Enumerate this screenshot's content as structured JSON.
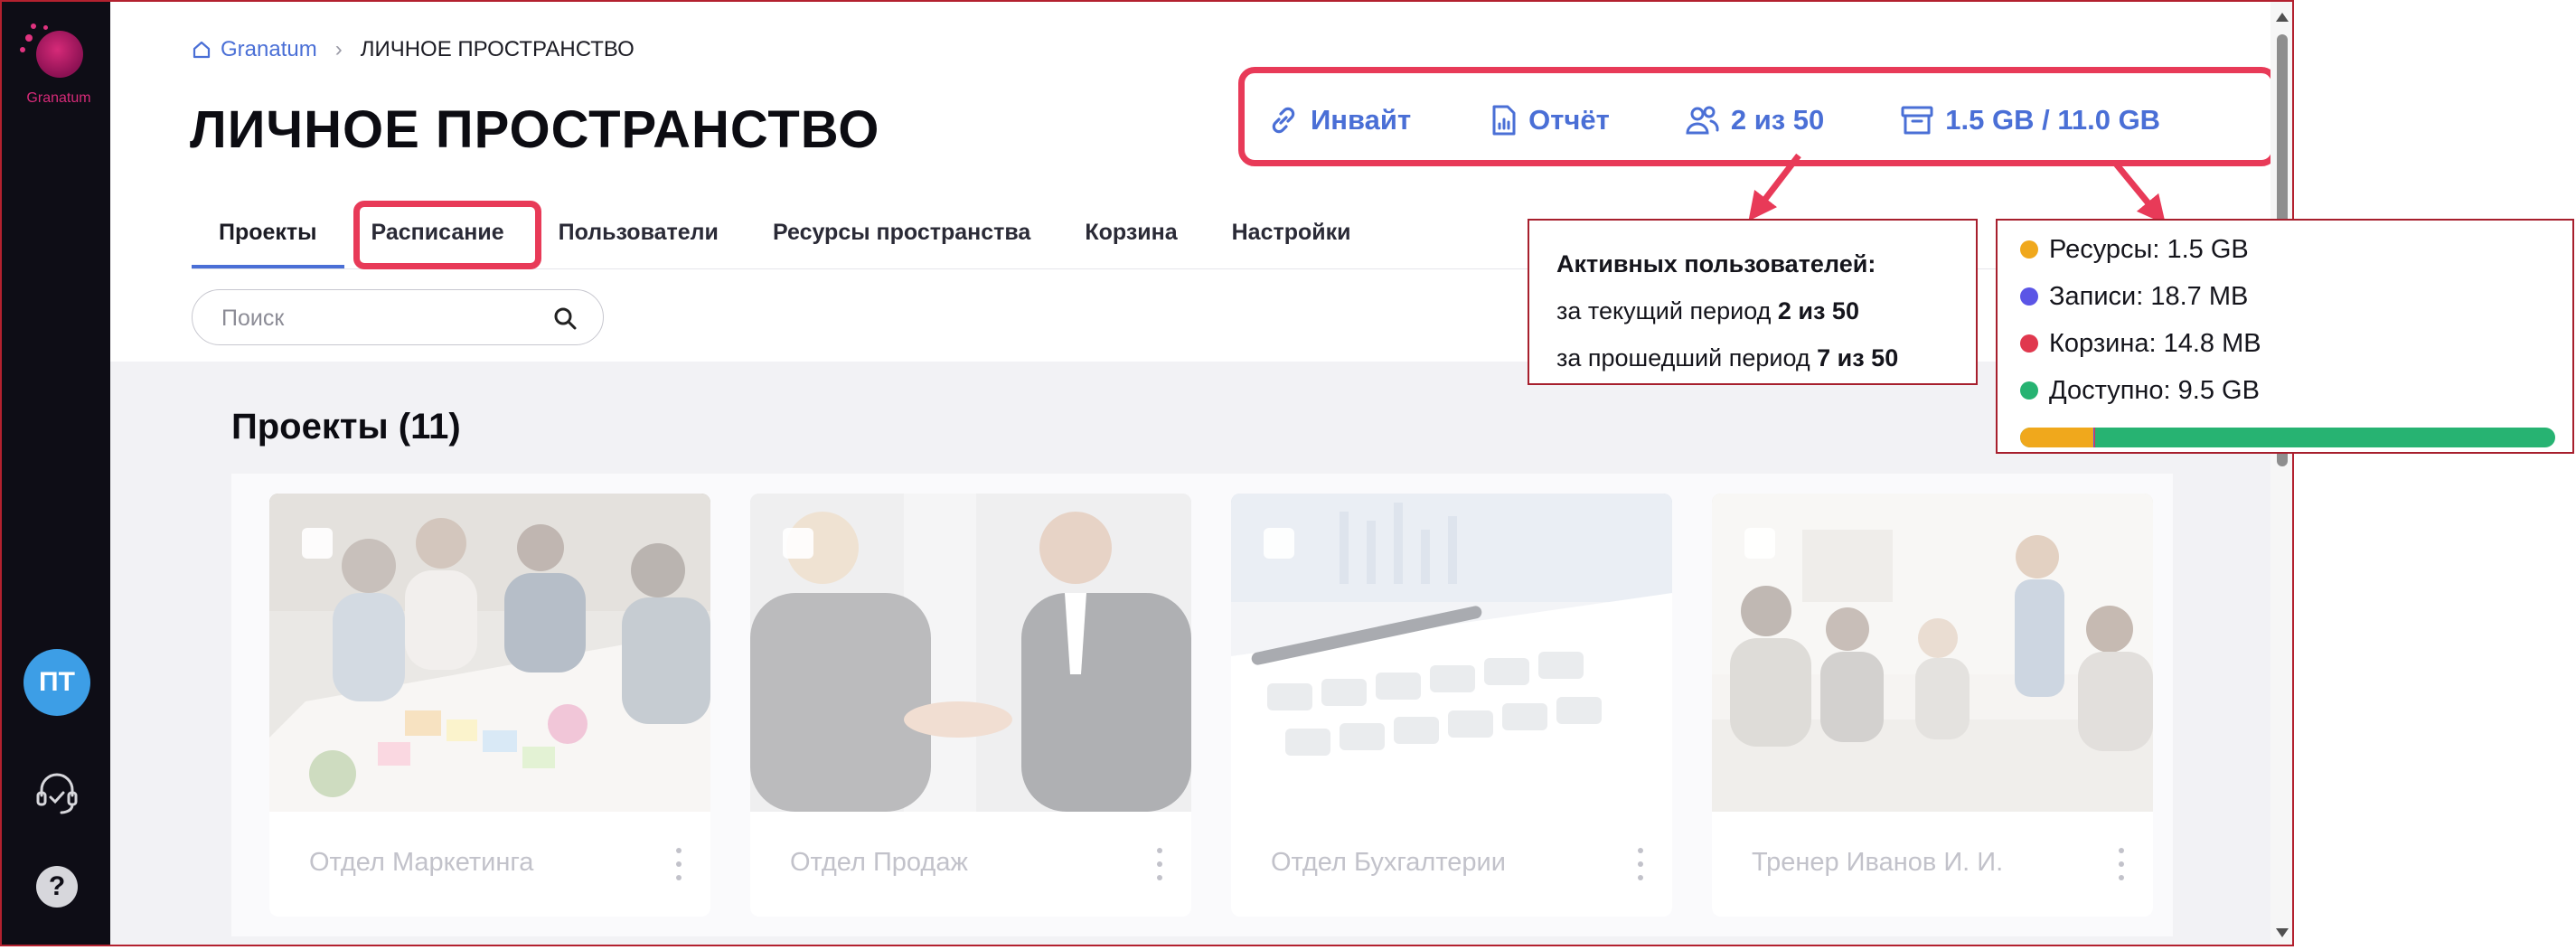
{
  "sidebar": {
    "logo_text": "Granatum",
    "avatar_initials": "ПТ",
    "help_label": "?"
  },
  "breadcrumb": {
    "home": "Granatum",
    "separator": "›",
    "current": "ЛИЧНОЕ ПРОСТРАНСТВО"
  },
  "page": {
    "title": "ЛИЧНОЕ ПРОСТРАНСТВО"
  },
  "tabs": [
    {
      "label": "Проекты",
      "active": true
    },
    {
      "label": "Расписание",
      "active": false
    },
    {
      "label": "Пользователи",
      "active": false
    },
    {
      "label": "Ресурсы пространства",
      "active": false
    },
    {
      "label": "Корзина",
      "active": false
    },
    {
      "label": "Настройки",
      "active": false
    }
  ],
  "stats": {
    "invite_label": "Инвайт",
    "report_label": "Отчёт",
    "users_label": "2 из 50",
    "storage_label": "1.5 GB / 11.0 GB",
    "icon_names": [
      "link-icon",
      "report-icon",
      "users-icon",
      "archive-icon"
    ]
  },
  "search": {
    "placeholder": "Поиск",
    "value": ""
  },
  "projects": {
    "title": "Проекты (11)",
    "cards": [
      {
        "title": "Отдел Маркетинга",
        "image": "team-meeting-photo"
      },
      {
        "title": "Отдел Продаж",
        "image": "handshake-photo"
      },
      {
        "title": "Отдел Бухгалтерии",
        "image": "calculator-photo"
      },
      {
        "title": "Тренер Иванов И. И.",
        "image": "presentation-photo"
      }
    ]
  },
  "callouts": {
    "users": {
      "heading": "Активных пользователей:",
      "current_prefix": "за текущий период ",
      "current_value": "2 из 50",
      "past_prefix": "за прошедший период ",
      "past_value": "7 из 50"
    },
    "storage": {
      "items": [
        {
          "label": "Ресурсы: 1.5 GB",
          "color": "#f0a81c"
        },
        {
          "label": "Записи: 18.7 MB",
          "color": "#5b55e6"
        },
        {
          "label": "Корзина: 14.8 MB",
          "color": "#e0384e"
        },
        {
          "label": "Доступно: 9.5 GB",
          "color": "#27b372"
        }
      ],
      "usage_fractions": {
        "resources": 0.136,
        "records": 0.0017,
        "trash": 0.0013,
        "available": 0.864
      }
    }
  },
  "colors": {
    "accent": "#4a6fd6",
    "highlight": "#e83a58",
    "sidebar_bg": "#0e0d16",
    "avatar_bg": "#3d9ee6",
    "callout_border": "#a71f2d"
  }
}
